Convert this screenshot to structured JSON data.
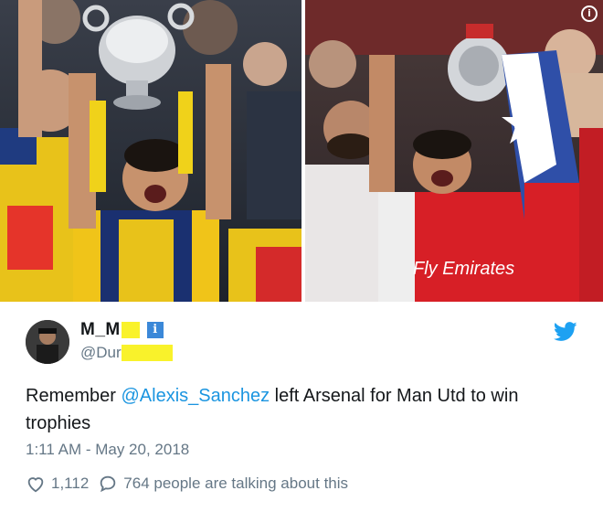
{
  "photos": {
    "left_alt": "Sanchez celebrating with FA Cup",
    "right_alt": "Sanchez lifting FA Cup with Chile flag",
    "info_icon": "info-icon",
    "shirt_sponsor": "Fly Emirates"
  },
  "tweet": {
    "display_name": "M_M",
    "handle": "@Dur",
    "verified_label": "i",
    "text_prefix": "Remember ",
    "mention": "@Alexis_Sanchez",
    "text_suffix": " left Arsenal for Man Utd to win trophies",
    "timestamp": "1:11 AM - May 20, 2018",
    "likes": "1,112",
    "talking": "764 people are talking about this",
    "icons": {
      "like": "heart-icon",
      "reply": "reply-icon",
      "brand": "twitter-bird-icon"
    }
  },
  "colors": {
    "twitter_blue": "#1da1f2",
    "mention_blue": "#1b95e0",
    "meta_gray": "#657786",
    "redaction_yellow": "#f9f22b",
    "arsenal_red": "#d71f26"
  }
}
